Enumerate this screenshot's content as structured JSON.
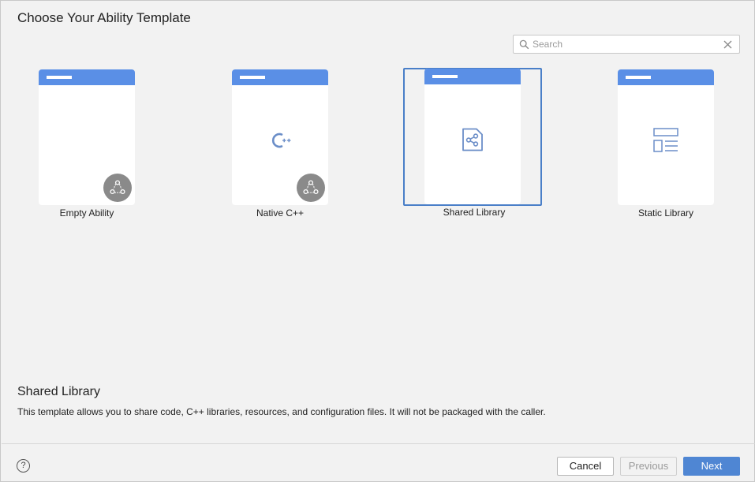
{
  "title": "Choose Your Ability Template",
  "search": {
    "placeholder": "Search",
    "value": ""
  },
  "templates": [
    {
      "label": "Empty Ability",
      "icon": "blank-page",
      "badge": "ability-badge-icon"
    },
    {
      "label": "Native C++",
      "icon": "cpp-icon",
      "badge": "ability-badge-icon"
    },
    {
      "label": "Shared Library",
      "icon": "shared-library-icon",
      "selected": true
    },
    {
      "label": "Static Library",
      "icon": "static-library-icon"
    }
  ],
  "description": {
    "title": "Shared Library",
    "text": "This template allows you to share code, C++ libraries, resources, and configuration files. It will not be packaged with the caller."
  },
  "footer": {
    "help": "?",
    "cancel": "Cancel",
    "previous": "Previous",
    "next": "Next"
  },
  "colors": {
    "accent": "#5a8fe6",
    "selected_border": "#4a7fc8",
    "primary_button": "#4f86d3",
    "icon": "#6b8ec8",
    "badge": "#8a8a8a"
  }
}
